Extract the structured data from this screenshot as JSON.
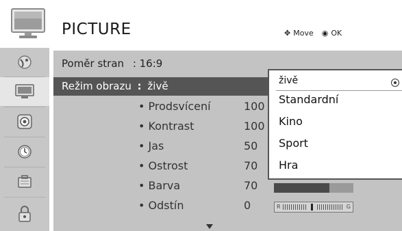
{
  "header": {
    "title": "PICTURE",
    "icon": "tv-monitor-icon",
    "hints": {
      "move_symbol": "✥",
      "move_label": "Move",
      "ok_symbol": "◉",
      "ok_label": "OK"
    }
  },
  "sidebar": {
    "items": [
      {
        "name": "sidebar-item-setup",
        "icon": "satellite-dish-icon",
        "active": false
      },
      {
        "name": "sidebar-item-picture",
        "icon": "tv-icon",
        "active": true
      },
      {
        "name": "sidebar-item-audio",
        "icon": "speaker-icon",
        "active": false
      },
      {
        "name": "sidebar-item-time",
        "icon": "clock-icon",
        "active": false
      },
      {
        "name": "sidebar-item-option",
        "icon": "briefcase-icon",
        "active": false
      },
      {
        "name": "sidebar-item-lock",
        "icon": "lock-icon",
        "active": false
      }
    ]
  },
  "menu": {
    "aspect_ratio_label": "Poměr stran",
    "aspect_ratio_value": ": 16:9",
    "picture_mode_label": "Režim obrazu",
    "picture_mode_sep": ":",
    "picture_mode_value": "živě",
    "settings": [
      {
        "label": "• Prodsvícení",
        "value": "100",
        "level": 1.0
      },
      {
        "label": "• Kontrast",
        "value": "100",
        "level": 1.0
      },
      {
        "label": "• Jas",
        "value": "50",
        "level": 0.5
      },
      {
        "label": "• Ostrost",
        "value": "70",
        "level": 0.7
      },
      {
        "label": "• Barva",
        "value": "70",
        "level": 0.7
      },
      {
        "label": "• Odstín",
        "value": "0",
        "tint": {
          "left": "R",
          "right": "G",
          "position": 0.5
        }
      }
    ]
  },
  "dropdown": {
    "options": [
      "živě",
      "Standardní",
      "Kino",
      "Sport",
      "Hra"
    ],
    "selected": "živě"
  },
  "colors": {
    "panel": "#c3c3c3",
    "sidebar": "#c7c7c7",
    "highlight_row": "#555555",
    "bar_fill": "#4a4a4a",
    "bar_track": "#9a9a9a"
  }
}
